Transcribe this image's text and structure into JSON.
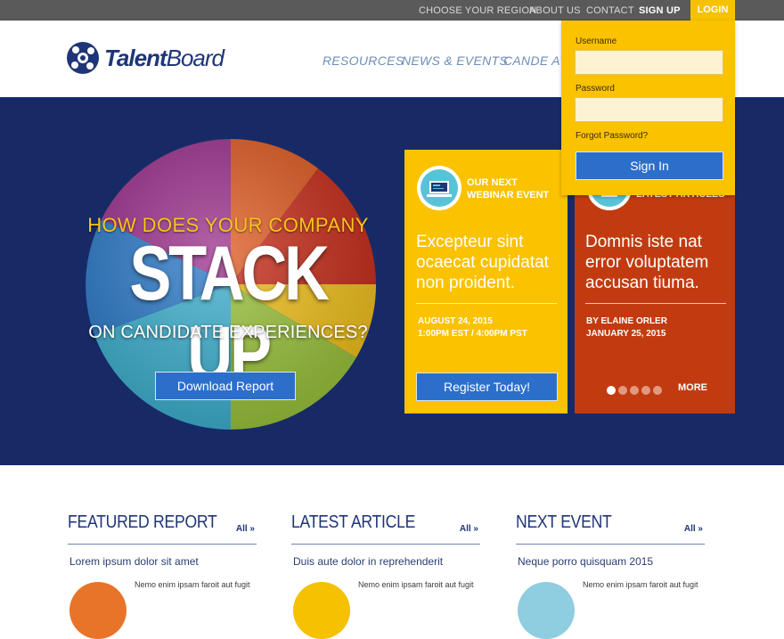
{
  "topbar": {
    "links": [
      "CHOOSE YOUR REGION",
      "ABOUT US",
      "CONTACT"
    ],
    "signup_label": "SIGN UP",
    "login_label": "LOGIN"
  },
  "header": {
    "logo_bold": "Talent",
    "logo_light": "Board",
    "nav": [
      "RESOURCES",
      "NEWS & EVENTS",
      "CANDE AW"
    ]
  },
  "hero": {
    "kicker": "HOW DOES YOUR COMPANY",
    "title": "STACK UP",
    "subtitle": "ON CANDIDATE EXPERIENCES?",
    "download_label": "Download Report"
  },
  "webinar_card": {
    "heading": [
      "OUR NEXT",
      "WEBINAR EVENT"
    ],
    "body": "Excepteur sint ocaecat cupidatat non proident.",
    "date": "AUGUST 24, 2015",
    "time": "1:00PM EST / 4:00PM PST",
    "register_label": "Register Today!",
    "icon": "monitor-icon"
  },
  "article_card": {
    "heading": "LATEST ARTICLES",
    "body": "Domnis iste nat error voluptatem accusan tiuma.",
    "author": "BY ELAINE ORLER",
    "date": "JANUARY 25, 2015",
    "more_label": "MORE",
    "carousel_active_index": 0,
    "carousel_count": 5,
    "icon": "article-icon"
  },
  "login": {
    "username_label": "Username",
    "password_label": "Password",
    "forgot_label": "Forgot Password?",
    "signin_label": "Sign In"
  },
  "sections": [
    {
      "title": "FEATURED REPORT",
      "all_label": "All »",
      "headline": "Lorem ipsum dolor sit amet",
      "excerpt": "Nemo enim ipsam faroit aut fugit",
      "thumb_color": "#e8742a"
    },
    {
      "title": "LATEST ARTICLE",
      "all_label": "All »",
      "headline": "Duis aute dolor in reprehenderit",
      "excerpt": "Nemo enim ipsam faroit aut fugit",
      "thumb_color": "#f5c100"
    },
    {
      "title": "NEXT EVENT",
      "all_label": "All »",
      "headline": "Neque porro quisquam 2015",
      "excerpt": "Nemo enim ipsam faroit aut fugit",
      "thumb_color": "#8fcde0"
    }
  ],
  "colors": {
    "brand_navy": "#172a66",
    "accent_yellow": "#fbc200",
    "accent_red": "#c23b10",
    "button_blue": "#2c6fcb"
  }
}
